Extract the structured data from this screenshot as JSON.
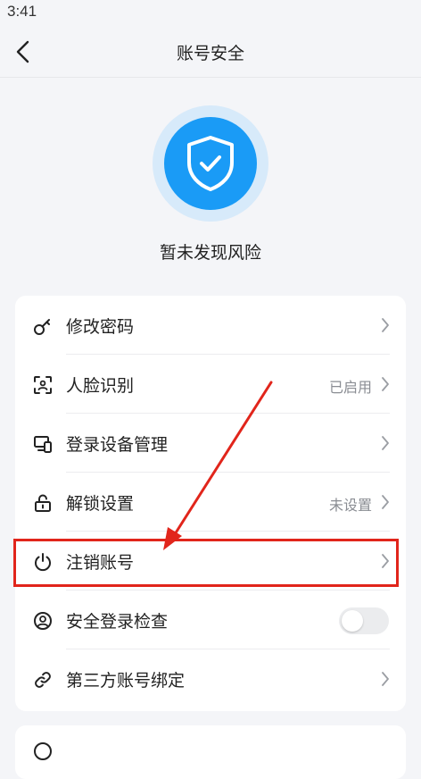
{
  "status_bar": {
    "time": "3:41"
  },
  "nav": {
    "title": "账号安全"
  },
  "security_status": {
    "text": "暂未发现风险"
  },
  "menu": [
    {
      "label": "修改密码",
      "status": "",
      "icon": "key-icon"
    },
    {
      "label": "人脸识别",
      "status": "已启用",
      "icon": "face-scan-icon"
    },
    {
      "label": "登录设备管理",
      "status": "",
      "icon": "devices-icon"
    },
    {
      "label": "解锁设置",
      "status": "未设置",
      "icon": "unlock-icon"
    },
    {
      "label": "注销账号",
      "status": "",
      "icon": "power-icon"
    },
    {
      "label": "安全登录检查",
      "status": "",
      "icon": "user-circle-icon",
      "toggle_on": false
    },
    {
      "label": "第三方账号绑定",
      "status": "",
      "icon": "link-icon"
    }
  ],
  "annotation": {
    "highlight_color": "#e1251b"
  },
  "colors": {
    "accent": "#1a9bf6",
    "shield_halo": "#d7eafa",
    "background": "#f4f5f8"
  }
}
